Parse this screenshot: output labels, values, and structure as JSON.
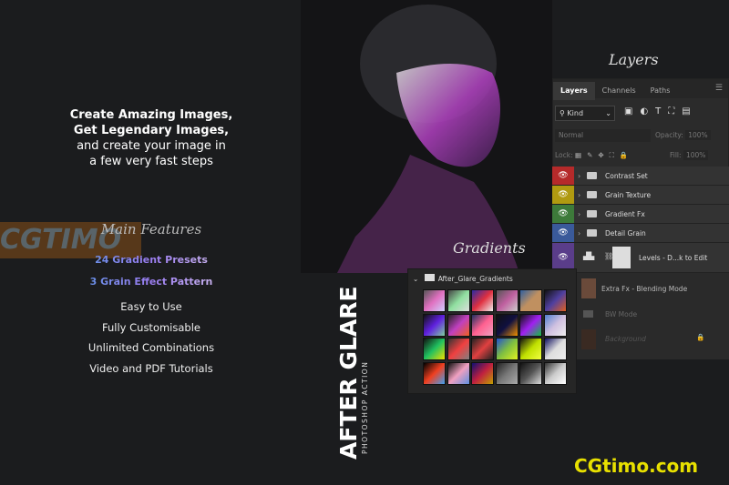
{
  "headline": [
    "Create Amazing Images,",
    "Get Legendary Images,",
    "and create your image in",
    "a few very fast steps"
  ],
  "features_title": "Main Features",
  "highlights": [
    "24 Gradient Presets",
    "3 Grain Effect Pattern"
  ],
  "features": [
    "Easy to Use",
    "Fully Customisable",
    "Unlimited Combinations",
    "Video and PDF Tutorials"
  ],
  "product": {
    "title": "AFTER GLARE",
    "subtitle": "PHOTOSHOP ACTION"
  },
  "labels": {
    "layers": "Layers",
    "gradients": "Gradients"
  },
  "layers_panel": {
    "tabs": [
      "Layers",
      "Channels",
      "Paths"
    ],
    "kind": "Kind",
    "blend": "Normal",
    "opacity_label": "Opacity:",
    "opacity": "100%",
    "lock_label": "Lock:",
    "fill_label": "Fill:",
    "fill": "100%",
    "layers": [
      {
        "name": "Contrast Set",
        "color": "#b52a2a"
      },
      {
        "name": "Grain Texture",
        "color": "#b09a10"
      },
      {
        "name": "Gradient Fx",
        "color": "#3d7a3a"
      },
      {
        "name": "Detail Grain",
        "color": "#3a5a9a"
      },
      {
        "name": "Levels - D...k to Edit",
        "color": "#5a3d8a"
      }
    ],
    "lower_layers": [
      "Extra Fx - Blending Mode",
      "BW Mode",
      "Background"
    ]
  },
  "gradients_panel": {
    "folder": "After_Glare_Gradients",
    "swatches": [
      [
        "#555",
        "#e070c0",
        "#d0d0ff"
      ],
      [
        "#444",
        "#90e0a0",
        "#ddd"
      ],
      [
        "#2a2aa0",
        "#e03040",
        "#eee"
      ],
      [
        "#555",
        "#c060a0",
        "#ccc"
      ],
      [
        "#3060a0",
        "#c09060",
        "#c09060"
      ],
      [
        "#111",
        "#5040a0",
        "#e06020"
      ],
      [
        "#111",
        "#6020e0",
        "#80d0a0"
      ],
      [
        "#222",
        "#c040c0",
        "#f06020"
      ],
      [
        "#203060",
        "#ff6090",
        "#f0a0c0"
      ],
      [
        "#111",
        "#101040",
        "#f09000"
      ],
      [
        "#111",
        "#a020f0",
        "#10c040"
      ],
      [
        "#5080d0",
        "#d0c0e0",
        "#eee"
      ],
      [
        "#111",
        "#20c060",
        "#f0e000"
      ],
      [
        "#333",
        "#f04040",
        "#808080"
      ],
      [
        "#222",
        "#e04040",
        "#222"
      ],
      [
        "#2050d0",
        "#80c040",
        "#e0f020"
      ],
      [
        "#111",
        "#c0e000",
        "#f0ff40"
      ],
      [
        "#101060",
        "#ddd",
        "#eee"
      ],
      [
        "#000",
        "#f04020",
        "#40a0f0"
      ],
      [
        "#111",
        "#f0a0c0",
        "#6090e0"
      ],
      [
        "#101070",
        "#c02040",
        "#c0a000"
      ],
      [
        "#222",
        "#777",
        "#aaa"
      ],
      [
        "#111",
        "#555",
        "#ddd"
      ],
      [
        "#333",
        "#ccc",
        "#fff"
      ]
    ]
  },
  "watermarks": {
    "left": "CGTIMO",
    "right": "CGtimo.com"
  }
}
